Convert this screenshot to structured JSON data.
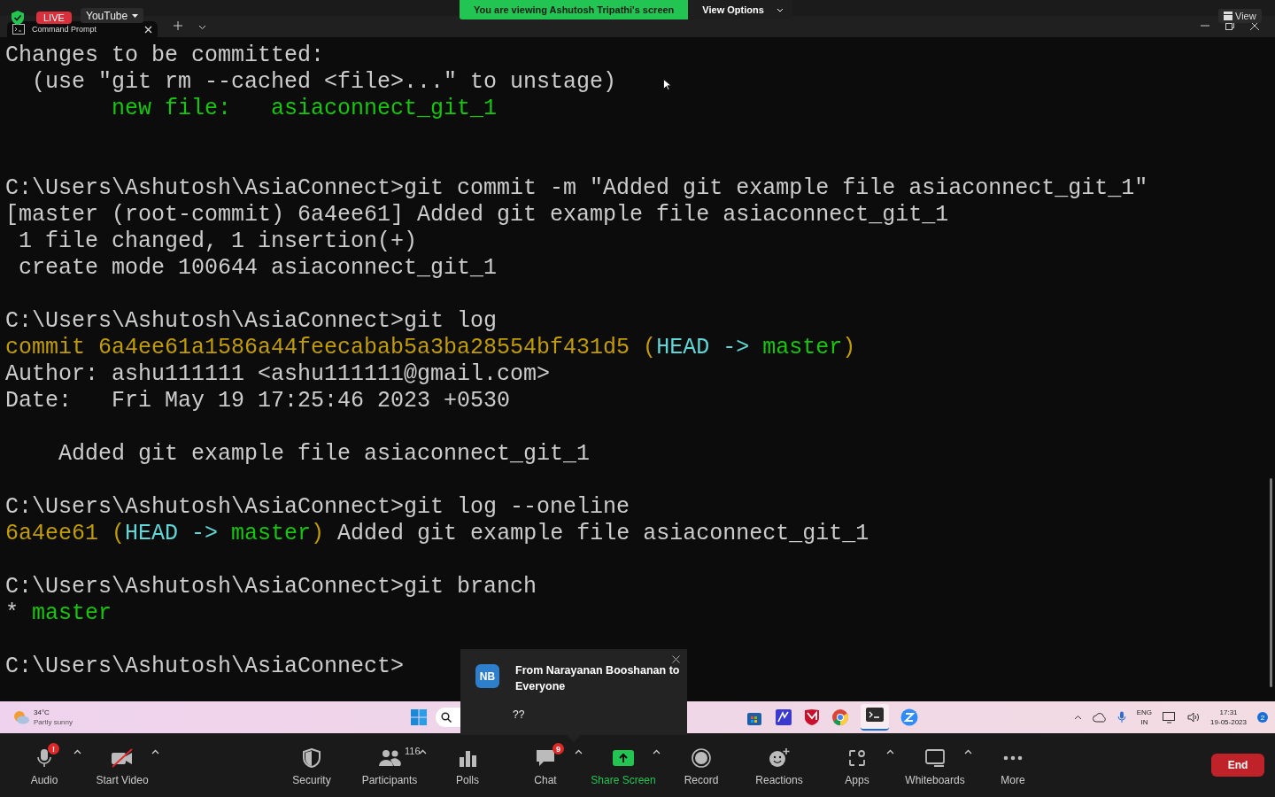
{
  "overlay": {
    "live_badge": "LIVE",
    "stream_menu": "YouTube",
    "banner": "You are viewing Ashutosh Tripathi's screen",
    "view_options": "View Options",
    "view_button": "View"
  },
  "terminal_tab": {
    "title": "Command Prompt"
  },
  "terminal": {
    "lines": [
      {
        "kind": "text",
        "segments": [
          {
            "text": "Changes to be committed:",
            "color": "#cccccc"
          }
        ]
      },
      {
        "kind": "text",
        "segments": [
          {
            "text": "  (use \"git rm --cached <file>...\" to unstage)",
            "color": "#cccccc"
          }
        ]
      },
      {
        "kind": "text",
        "segments": [
          {
            "text": "        new file:   asiaconnect_git_1",
            "color": "#16c60c"
          }
        ]
      },
      {
        "kind": "blank"
      },
      {
        "kind": "blank"
      },
      {
        "kind": "text",
        "segments": [
          {
            "text": "C:\\Users\\Ashutosh\\AsiaConnect>git commit -m \"Added git example file asiaconnect_git_1\"",
            "color": "#cccccc"
          }
        ]
      },
      {
        "kind": "text",
        "segments": [
          {
            "text": "[master (root-commit) 6a4ee61] Added git example file asiaconnect_git_1",
            "color": "#cccccc"
          }
        ]
      },
      {
        "kind": "text",
        "segments": [
          {
            "text": " 1 file changed, 1 insertion(+)",
            "color": "#cccccc"
          }
        ]
      },
      {
        "kind": "text",
        "segments": [
          {
            "text": " create mode 100644 asiaconnect_git_1",
            "color": "#cccccc"
          }
        ]
      },
      {
        "kind": "blank"
      },
      {
        "kind": "text",
        "segments": [
          {
            "text": "C:\\Users\\Ashutosh\\AsiaConnect>git log",
            "color": "#cccccc"
          }
        ]
      },
      {
        "kind": "text",
        "segments": [
          {
            "text": "commit 6a4ee61a1586a44feecabab5a3ba28554bf431d5 (",
            "color": "#c19c00"
          },
          {
            "text": "HEAD -> ",
            "color": "#61d6d6"
          },
          {
            "text": "master",
            "color": "#16c60c"
          },
          {
            "text": ")",
            "color": "#c19c00"
          }
        ]
      },
      {
        "kind": "text",
        "segments": [
          {
            "text": "Author: ashu111111 <ashu111111@gmail.com>",
            "color": "#cccccc"
          }
        ]
      },
      {
        "kind": "text",
        "segments": [
          {
            "text": "Date:   Fri May 19 17:25:46 2023 +0530",
            "color": "#cccccc"
          }
        ]
      },
      {
        "kind": "blank"
      },
      {
        "kind": "text",
        "segments": [
          {
            "text": "    Added git example file asiaconnect_git_1",
            "color": "#cccccc"
          }
        ]
      },
      {
        "kind": "blank"
      },
      {
        "kind": "text",
        "segments": [
          {
            "text": "C:\\Users\\Ashutosh\\AsiaConnect>git log --oneline",
            "color": "#cccccc"
          }
        ]
      },
      {
        "kind": "text",
        "segments": [
          {
            "text": "6a4ee61 (",
            "color": "#c19c00"
          },
          {
            "text": "HEAD -> ",
            "color": "#61d6d6"
          },
          {
            "text": "master",
            "color": "#16c60c"
          },
          {
            "text": ")",
            "color": "#c19c00"
          },
          {
            "text": " Added git example file asiaconnect_git_1",
            "color": "#cccccc"
          }
        ]
      },
      {
        "kind": "blank"
      },
      {
        "kind": "text",
        "segments": [
          {
            "text": "C:\\Users\\Ashutosh\\AsiaConnect>git branch",
            "color": "#cccccc"
          }
        ]
      },
      {
        "kind": "text",
        "segments": [
          {
            "text": "* ",
            "color": "#cccccc"
          },
          {
            "text": "master",
            "color": "#16c60c"
          }
        ]
      },
      {
        "kind": "blank"
      },
      {
        "kind": "text",
        "segments": [
          {
            "text": "C:\\Users\\Ashutosh\\AsiaConnect>",
            "color": "#cccccc"
          }
        ]
      }
    ]
  },
  "taskbar": {
    "weather": {
      "temperature": "34°C",
      "condition": "Partly sunny"
    },
    "tray": {
      "language": "ENG",
      "region": "IN",
      "time": "17:31",
      "date": "19-05-2023",
      "notification_count": "2"
    }
  },
  "chat_toast": {
    "initials": "NB",
    "title": "From Narayanan Booshanan to Everyone",
    "message": "??"
  },
  "meeting_toolbar": {
    "items": [
      {
        "label": "Audio",
        "badge": "!",
        "caret": true,
        "highlighted": false
      },
      {
        "label": "Start Video",
        "caret": true,
        "highlighted": false
      },
      {
        "label": "Security",
        "caret": false,
        "highlighted": false
      },
      {
        "label": "Participants",
        "count": "116",
        "caret": true,
        "highlighted": false
      },
      {
        "label": "Polls",
        "caret": false,
        "highlighted": false
      },
      {
        "label": "Chat",
        "badge": "9",
        "caret": true,
        "highlighted": false
      },
      {
        "label": "Share Screen",
        "caret": true,
        "highlighted": true
      },
      {
        "label": "Record",
        "caret": false,
        "highlighted": false
      },
      {
        "label": "Reactions",
        "caret": false,
        "highlighted": false
      },
      {
        "label": "Apps",
        "caret": true,
        "highlighted": false
      },
      {
        "label": "Whiteboards",
        "caret": true,
        "highlighted": false
      },
      {
        "label": "More",
        "caret": false,
        "highlighted": false
      }
    ],
    "end_button": "End"
  }
}
